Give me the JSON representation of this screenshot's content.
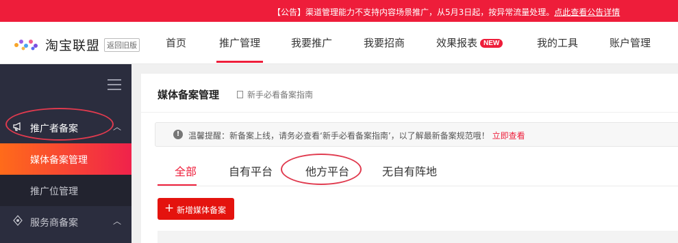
{
  "notice": {
    "text": "【公告】渠道管理能力不支持内容场景推广，从5月3日起，按异常流量处理。",
    "link": "点此查看公告详情"
  },
  "header": {
    "brand": "淘宝联盟",
    "old_version": "返回旧版",
    "nav": [
      "首页",
      "推广管理",
      "我要推广",
      "我要招商",
      "效果报表",
      "我的工具",
      "账户管理"
    ],
    "new_badge": "NEW"
  },
  "sidebar": {
    "group_promoter": "推广者备案",
    "item_media": "媒体备案管理",
    "item_adzone": "推广位管理",
    "group_service": "服务商备案"
  },
  "main": {
    "title": "媒体备案管理",
    "guide": "新手必看备案指南",
    "alert_text": "温馨提醒：新备案上线，请务必查看‘新手必看备案指南’，以了解最新备案规范哦！",
    "alert_link": "立即查看",
    "tabs": [
      "全部",
      "自有平台",
      "他方平台",
      "无自有阵地"
    ],
    "add_button": "新增媒体备案"
  },
  "colors": {
    "accent": "#ee1d3a",
    "sidebar_bg": "#2b2d3e",
    "annotation": "#e03a4e"
  },
  "icons": [
    "logo-icon",
    "menu-toggle-icon",
    "megaphone-icon",
    "chevron-up-icon",
    "document-icon",
    "warning-icon",
    "plus-icon",
    "service-icon"
  ]
}
